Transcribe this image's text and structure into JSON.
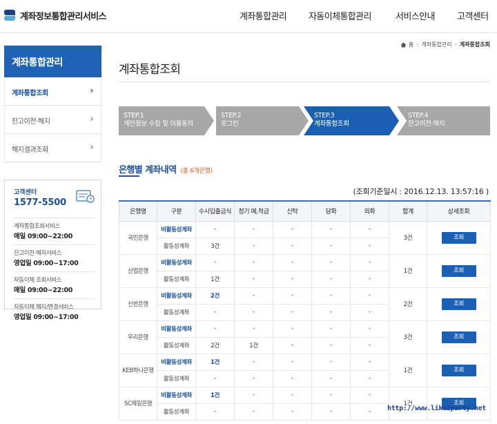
{
  "header": {
    "logo_text": "계좌정보통합관리서비스",
    "nav": [
      "계좌통합관리",
      "자동이체통합관리",
      "서비스안내",
      "고객센터"
    ]
  },
  "sidebar": {
    "title": "계좌통합관리",
    "items": [
      {
        "label": "계좌통합조회",
        "active": true
      },
      {
        "label": "잔고이전·해지",
        "active": false
      },
      {
        "label": "해지결과조회",
        "active": false
      }
    ],
    "support": {
      "label": "고객센터",
      "phone": "1577-5500",
      "hours": [
        {
          "name": "계좌통합조회서비스",
          "time": "매일 09:00~22:00"
        },
        {
          "name": "잔고이전·해지서비스",
          "time": "영업일 09:00~17:00"
        },
        {
          "name": "자동이체 조회서비스",
          "time": "매일 09:00~22:00"
        },
        {
          "name": "자동이체 해지/변경서비스",
          "time": "영업일 09:00~17:00"
        }
      ]
    }
  },
  "breadcrumb": {
    "home": "홈",
    "items": [
      "계좌통합관리",
      "계좌통합조회"
    ]
  },
  "page_title": "계좌통합조회",
  "steps": [
    {
      "step": "STEP.1",
      "label": "개인정보 수집 및 이용동의",
      "active": false
    },
    {
      "step": "STEP.2",
      "label": "로그인",
      "active": false
    },
    {
      "step": "STEP.3",
      "label": "계좌통합조회",
      "active": true
    },
    {
      "step": "STEP.4",
      "label": "잔고이전·해지",
      "active": false
    }
  ],
  "section": {
    "title": "은행별 계좌내역",
    "count": "(총 6개은행)"
  },
  "asof": "(조회기준일시 : 2016.12.13. 13:57:16 )",
  "table": {
    "headers": [
      "은행명",
      "구분",
      "수시입출금식",
      "정기 예,적금",
      "신탁",
      "담화",
      "외화",
      "합계",
      "상세조회"
    ],
    "button_label": "조회",
    "rows": [
      {
        "bank": "국민은행",
        "total": "3건",
        "inactive": {
          "type": "비활동성계좌",
          "cells": [
            "-",
            "-",
            "-",
            "-",
            "-"
          ]
        },
        "active": {
          "type": "활동성계좌",
          "cells": [
            "3건",
            "-",
            "-",
            "-",
            "-"
          ]
        }
      },
      {
        "bank": "산업은행",
        "total": "1건",
        "inactive": {
          "type": "비활동성계좌",
          "cells": [
            "-",
            "-",
            "-",
            "-",
            "-"
          ]
        },
        "active": {
          "type": "활동성계좌",
          "cells": [
            "1건",
            "-",
            "-",
            "-",
            "-"
          ]
        }
      },
      {
        "bank": "신한은행",
        "total": "2건",
        "inactive": {
          "type": "비활동성계좌",
          "cells": [
            "2건",
            "-",
            "-",
            "-",
            "-"
          ]
        },
        "active": {
          "type": "활동성계좌",
          "cells": [
            "-",
            "-",
            "-",
            "-",
            "-"
          ]
        }
      },
      {
        "bank": "우리은행",
        "total": "3건",
        "inactive": {
          "type": "비활동성계좌",
          "cells": [
            "-",
            "-",
            "-",
            "-",
            "-"
          ]
        },
        "active": {
          "type": "활동성계좌",
          "cells": [
            "2건",
            "1건",
            "-",
            "-",
            "-"
          ]
        }
      },
      {
        "bank": "KEB하나은행",
        "total": "1건",
        "inactive": {
          "type": "비활동성계좌",
          "cells": [
            "1건",
            "-",
            "-",
            "-",
            "-"
          ]
        },
        "active": {
          "type": "활동성계좌",
          "cells": [
            "-",
            "-",
            "-",
            "-",
            "-"
          ]
        }
      },
      {
        "bank": "SC제일은행",
        "total": "1건",
        "inactive": {
          "type": "비활동성계좌",
          "cells": [
            "1건",
            "-",
            "-",
            "-",
            "-"
          ]
        },
        "active": {
          "type": "활동성계좌",
          "cells": [
            "-",
            "-",
            "-",
            "-",
            "-"
          ]
        }
      }
    ]
  },
  "watermark": "http://www.like2party.net",
  "colors": {
    "primary": "#1f63b6",
    "step_inactive": "#a7a7a7",
    "step_active": "#1a5fb4",
    "count_accent": "#e15b1d"
  }
}
